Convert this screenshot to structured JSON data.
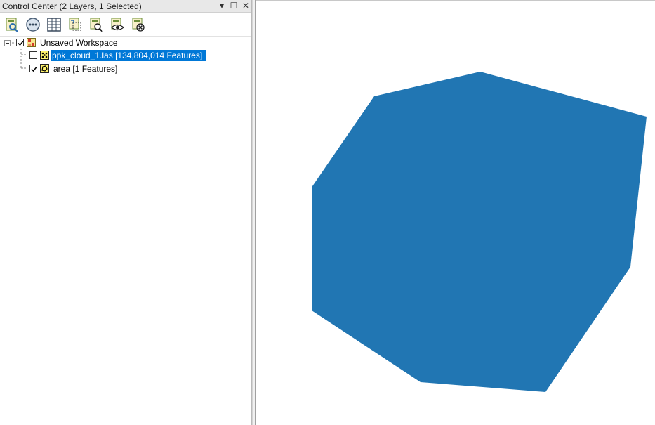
{
  "window": {
    "title": "Control Center (2 Layers, 1 Selected)",
    "pin_glyph": "▾",
    "maximize_glyph": "☐",
    "close_glyph": "✕"
  },
  "toolbar": {
    "tools": [
      {
        "icon": "add-data-icon"
      },
      {
        "icon": "layer-options-icon"
      },
      {
        "icon": "attribute-table-icon"
      },
      {
        "icon": "select-layer-icon"
      },
      {
        "icon": "zoom-to-layer-icon"
      },
      {
        "icon": "view-layer-icon"
      },
      {
        "icon": "remove-layer-icon"
      }
    ]
  },
  "tree": {
    "workspace": {
      "label": "Unsaved Workspace",
      "checked": true,
      "expanded": true
    },
    "layers": [
      {
        "label": "ppk_cloud_1.las [134,804,014 Features]",
        "checked": false,
        "selected": true,
        "icon": "point-cloud-icon"
      },
      {
        "label": "area [1 Features]",
        "checked": true,
        "selected": false,
        "icon": "polygon-layer-icon"
      }
    ]
  },
  "map": {
    "polygon_color": "#2176b3",
    "selection_color": "#0078d7"
  }
}
